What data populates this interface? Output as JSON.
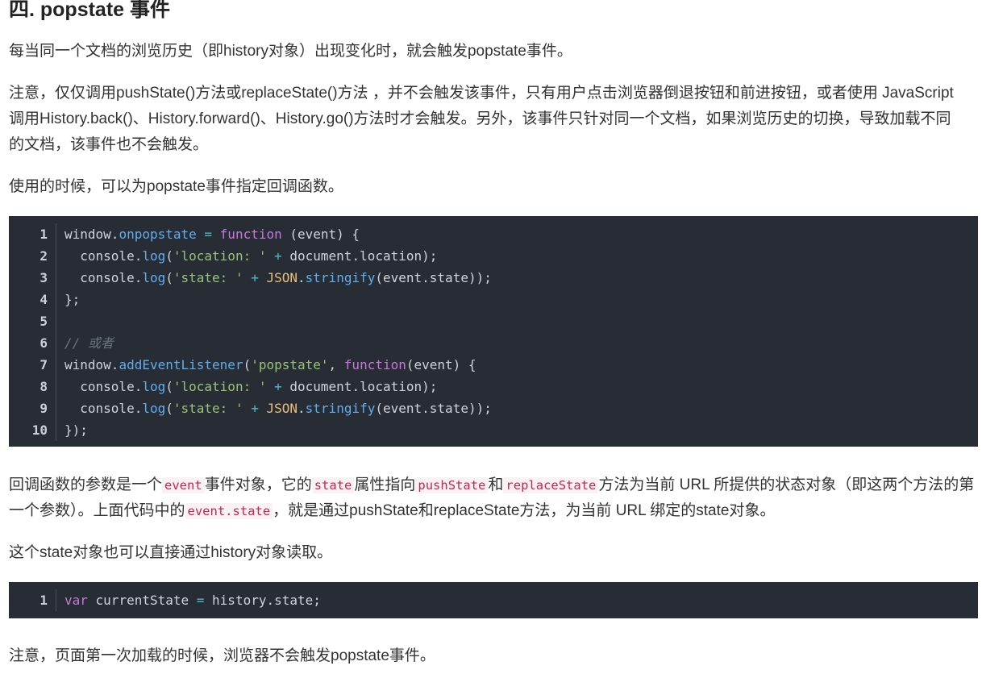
{
  "heading": "四. popstate 事件",
  "paragraphs": {
    "p1": "每当同一个文档的浏览历史（即history对象）出现变化时，就会触发popstate事件。",
    "p2": "注意，仅仅调用pushState()方法或replaceState()方法 ，并不会触发该事件，只有用户点击浏览器倒退按钮和前进按钮，或者使用 JavaScript 调用History.back()、History.forward()、History.go()方法时才会触发。另外，该事件只针对同一个文档，如果浏览历史的切换，导致加载不同的文档，该事件也不会触发。",
    "p3": "使用的时候，可以为popstate事件指定回调函数。",
    "p4": {
      "t1": "回调函数的参数是一个",
      "c1": "event",
      "t2": "事件对象，它的",
      "c2": "state",
      "t3": "属性指向",
      "c3": "pushState",
      "t4": "和",
      "c4": "replaceState",
      "t5": "方法为当前 URL 所提供的状态对象（即这两个方法的第一个参数）。上面代码中的",
      "c5": "event.state",
      "t6": "，就是通过pushState和replaceState方法，为当前 URL 绑定的state对象。"
    },
    "p5": "这个state对象也可以直接通过history对象读取。",
    "p6": "注意，页面第一次加载的时候，浏览器不会触发popstate事件。"
  },
  "code_block_1": {
    "lines": [
      {
        "n": "1",
        "tokens": [
          {
            "t": "window.",
            "c": "plain"
          },
          {
            "t": "onpopstate",
            "c": "prop"
          },
          {
            "t": " = ",
            "c": "op"
          },
          {
            "t": "function",
            "c": "kw"
          },
          {
            "t": " (event) {",
            "c": "plain"
          }
        ]
      },
      {
        "n": "2",
        "tokens": [
          {
            "t": "  console.",
            "c": "plain"
          },
          {
            "t": "log",
            "c": "fn"
          },
          {
            "t": "(",
            "c": "plain"
          },
          {
            "t": "'location: '",
            "c": "str"
          },
          {
            "t": " + ",
            "c": "op"
          },
          {
            "t": "document.location);",
            "c": "plain"
          }
        ]
      },
      {
        "n": "3",
        "tokens": [
          {
            "t": "  console.",
            "c": "plain"
          },
          {
            "t": "log",
            "c": "fn"
          },
          {
            "t": "(",
            "c": "plain"
          },
          {
            "t": "'state: '",
            "c": "str"
          },
          {
            "t": " + ",
            "c": "op"
          },
          {
            "t": "JSON",
            "c": "builtin"
          },
          {
            "t": ".",
            "c": "plain"
          },
          {
            "t": "stringify",
            "c": "fn"
          },
          {
            "t": "(event.state));",
            "c": "plain"
          }
        ]
      },
      {
        "n": "4",
        "tokens": [
          {
            "t": "};",
            "c": "plain"
          }
        ]
      },
      {
        "n": "5",
        "tokens": []
      },
      {
        "n": "6",
        "tokens": [
          {
            "t": "// 或者",
            "c": "comment"
          }
        ]
      },
      {
        "n": "7",
        "tokens": [
          {
            "t": "window.",
            "c": "plain"
          },
          {
            "t": "addEventListener",
            "c": "fn"
          },
          {
            "t": "(",
            "c": "plain"
          },
          {
            "t": "'popstate'",
            "c": "str"
          },
          {
            "t": ", ",
            "c": "plain"
          },
          {
            "t": "function",
            "c": "kw"
          },
          {
            "t": "(event) {",
            "c": "plain"
          }
        ]
      },
      {
        "n": "8",
        "tokens": [
          {
            "t": "  console.",
            "c": "plain"
          },
          {
            "t": "log",
            "c": "fn"
          },
          {
            "t": "(",
            "c": "plain"
          },
          {
            "t": "'location: '",
            "c": "str"
          },
          {
            "t": " + ",
            "c": "op"
          },
          {
            "t": "document.location);",
            "c": "plain"
          }
        ]
      },
      {
        "n": "9",
        "tokens": [
          {
            "t": "  console.",
            "c": "plain"
          },
          {
            "t": "log",
            "c": "fn"
          },
          {
            "t": "(",
            "c": "plain"
          },
          {
            "t": "'state: '",
            "c": "str"
          },
          {
            "t": " + ",
            "c": "op"
          },
          {
            "t": "JSON",
            "c": "builtin"
          },
          {
            "t": ".",
            "c": "plain"
          },
          {
            "t": "stringify",
            "c": "fn"
          },
          {
            "t": "(event.state));",
            "c": "plain"
          }
        ]
      },
      {
        "n": "10",
        "tokens": [
          {
            "t": "});",
            "c": "plain"
          }
        ]
      }
    ]
  },
  "code_block_2": {
    "lines": [
      {
        "n": "1",
        "tokens": [
          {
            "t": "var",
            "c": "kw"
          },
          {
            "t": " currentState ",
            "c": "plain"
          },
          {
            "t": "=",
            "c": "op"
          },
          {
            "t": " history.state;",
            "c": "plain"
          }
        ]
      }
    ]
  },
  "colors": {
    "code_bg": "#282c34",
    "inline_code_fg": "#c7254e",
    "inline_code_bg": "#f9f2f4",
    "keyword": "#c678dd",
    "string": "#98c379",
    "function": "#61aeee"
  }
}
